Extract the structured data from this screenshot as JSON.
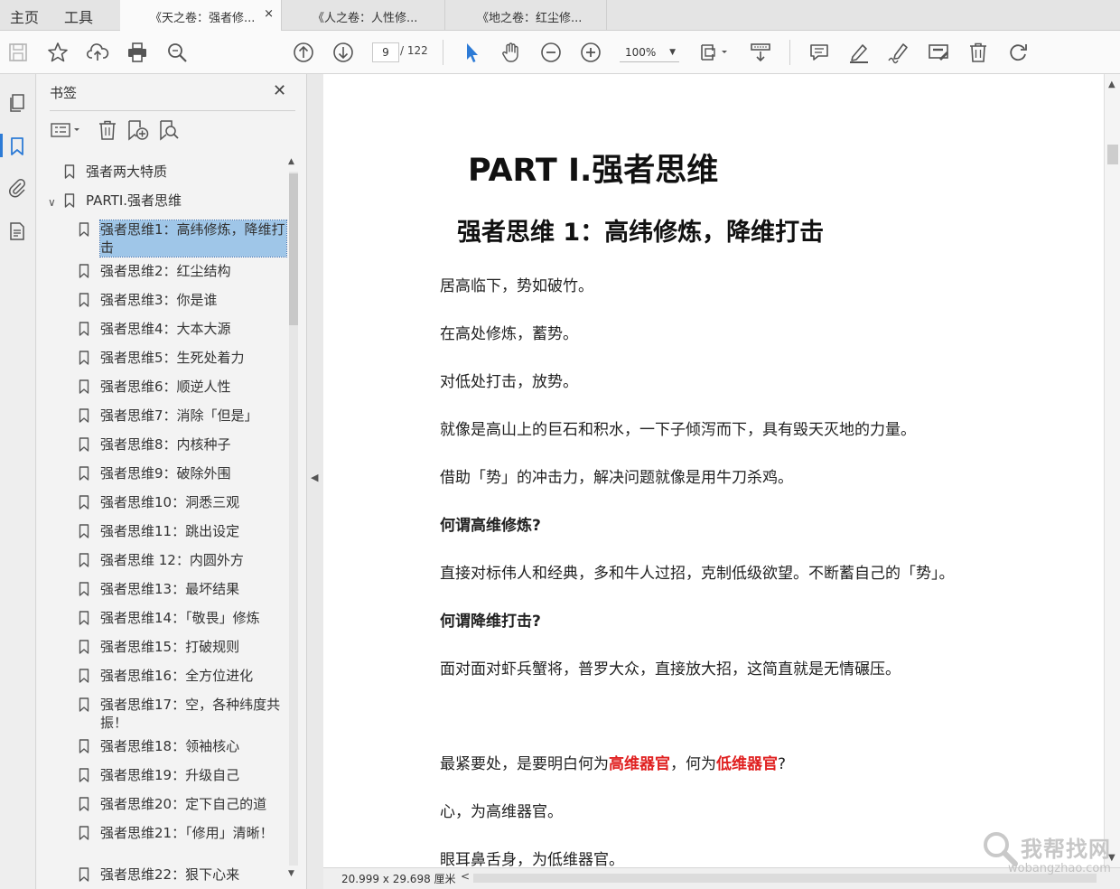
{
  "tabs": {
    "home": "主页",
    "tools": "工具",
    "documents": [
      {
        "label": "《天之卷：强者修...",
        "active": true
      },
      {
        "label": "《人之卷：人性修...",
        "active": false
      },
      {
        "label": "《地之卷：红尘修...",
        "active": false
      }
    ],
    "close_glyph": "×"
  },
  "toolbar": {
    "page_current": "9",
    "page_total": "/ 122",
    "zoom": "100%",
    "icons": [
      "save-icon",
      "star-icon",
      "upload-icon",
      "print-icon",
      "search-zoom-icon",
      "page-up-icon",
      "page-down-icon",
      "select-pointer-icon",
      "hand-tool-icon",
      "zoom-out-icon",
      "zoom-in-icon",
      "fit-page-icon",
      "scroll-mode-icon",
      "comment-icon",
      "highlight-icon",
      "sign-icon",
      "redact-icon",
      "delete-icon",
      "rotate-icon"
    ]
  },
  "panel": {
    "title": "书签",
    "close": "✕",
    "bookmarks": [
      {
        "label": "强者两大特质",
        "level": 0
      },
      {
        "label": "PARTⅠ.强者思维",
        "level": 0,
        "expanded": true
      },
      {
        "label": "强者思维1：高纬修炼，降维打击",
        "level": 1,
        "selected": true
      },
      {
        "label": "强者思维2：红尘结构",
        "level": 1
      },
      {
        "label": "强者思维3：你是谁",
        "level": 1
      },
      {
        "label": "强者思维4：大本大源",
        "level": 1
      },
      {
        "label": "强者思维5：生死处着力",
        "level": 1
      },
      {
        "label": "强者思维6：顺逆人性",
        "level": 1
      },
      {
        "label": "强者思维7：消除「但是」",
        "level": 1
      },
      {
        "label": "强者思维8：内核种子",
        "level": 1
      },
      {
        "label": "强者思维9：破除外围",
        "level": 1
      },
      {
        "label": "强者思维10：洞悉三观",
        "level": 1
      },
      {
        "label": "强者思维11：跳出设定",
        "level": 1
      },
      {
        "label": "强者思维 12：内圆外方",
        "level": 1
      },
      {
        "label": "强者思维13：最坏结果",
        "level": 1
      },
      {
        "label": "强者思维14：「敬畏」修炼",
        "level": 1
      },
      {
        "label": "强者思维15：打破规则",
        "level": 1
      },
      {
        "label": "强者思维16：全方位进化",
        "level": 1
      },
      {
        "label": "强者思维17：空，各种纬度共振！",
        "level": 1
      },
      {
        "label": "强者思维18：领袖核心",
        "level": 1
      },
      {
        "label": "强者思维19：升级自己",
        "level": 1
      },
      {
        "label": "强者思维20：定下自己的道",
        "level": 1
      },
      {
        "label": "强者思维21：「修用」清晰！",
        "level": 1
      },
      {
        "label": "强者思维22：狠下心来",
        "level": 1
      }
    ]
  },
  "document": {
    "h1": "PART Ⅰ.强者思维",
    "h2": "强者思维 1：高纬修炼，降维打击",
    "paragraphs": [
      {
        "text": "居高临下，势如破竹。",
        "bold": false
      },
      {
        "text": "在高处修炼，蓄势。",
        "bold": false
      },
      {
        "text": "对低处打击，放势。",
        "bold": false
      },
      {
        "text": "就像是高山上的巨石和积水，一下子倾泻而下，具有毁天灭地的力量。",
        "bold": false
      },
      {
        "text": "借助「势」的冲击力，解决问题就像是用牛刀杀鸡。",
        "bold": false
      },
      {
        "text": "何谓高维修炼?",
        "bold": true
      },
      {
        "text": "直接对标伟人和经典，多和牛人过招，克制低级欲望。不断蓄自己的「势」。",
        "bold": false
      },
      {
        "text": "何谓降维打击?",
        "bold": true
      },
      {
        "text": "面对面对虾兵蟹将，普罗大众，直接放大招，这简直就是无情碾压。",
        "bold": false
      }
    ],
    "mixed": {
      "part1": "最紧要处，是要明白何为",
      "red1": "高维器官",
      "part2": "，何为",
      "red2": "低维器官",
      "part3": "?"
    },
    "para_after_1": "心，为高维器官。",
    "para_after_2": "眼耳鼻舌身，为低维器官。",
    "accent_red": "#e02020"
  },
  "status": {
    "page_size": "20.999 x 29.698 厘米"
  },
  "watermark": {
    "text": "我帮找网",
    "url": "wobangzhao.com"
  }
}
